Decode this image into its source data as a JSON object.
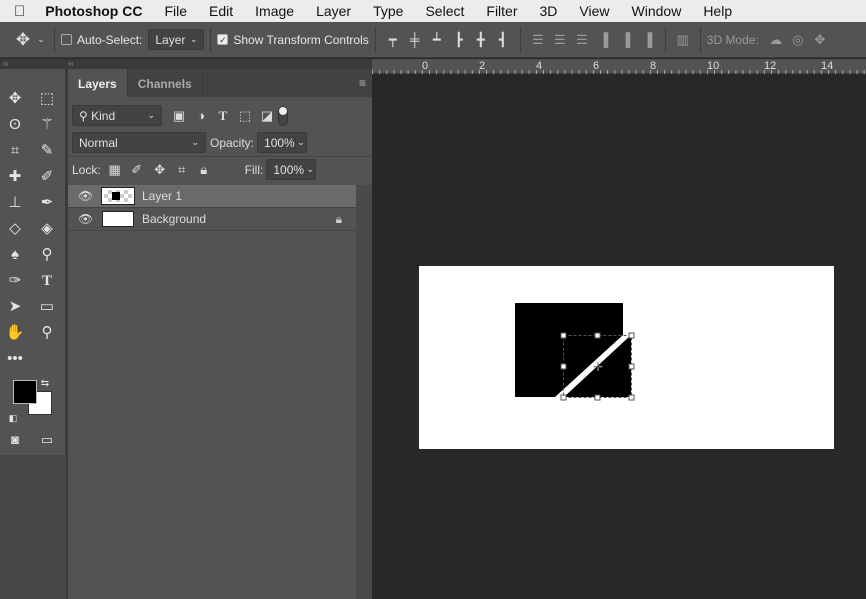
{
  "menubar": {
    "apple": "",
    "app": "Photoshop CC",
    "items": [
      "File",
      "Edit",
      "Image",
      "Layer",
      "Type",
      "Select",
      "Filter",
      "3D",
      "View",
      "Window",
      "Help"
    ]
  },
  "options": {
    "auto_select_label": "Auto-Select:",
    "auto_select_checked": false,
    "auto_select_target": "Layer",
    "show_transform_label": "Show Transform Controls",
    "show_transform_checked": true,
    "mode_3d_label": "3D Mode:"
  },
  "layers_panel": {
    "tabs": [
      "Layers",
      "Channels"
    ],
    "active_tab": "Layers",
    "filter_kind": "Kind",
    "blend_mode": "Normal",
    "opacity_label": "Opacity:",
    "opacity": "100%",
    "lock_label": "Lock:",
    "fill_label": "Fill:",
    "fill": "100%",
    "layers": [
      {
        "name": "Layer 1",
        "visible": true,
        "selected": true
      },
      {
        "name": "Background",
        "visible": true,
        "locked": true
      }
    ]
  },
  "ruler": {
    "ticks": [
      "0",
      "2",
      "4",
      "6",
      "8",
      "10",
      "12",
      "14"
    ]
  },
  "colors": {
    "foreground": "#000000",
    "background": "#ffffff"
  }
}
